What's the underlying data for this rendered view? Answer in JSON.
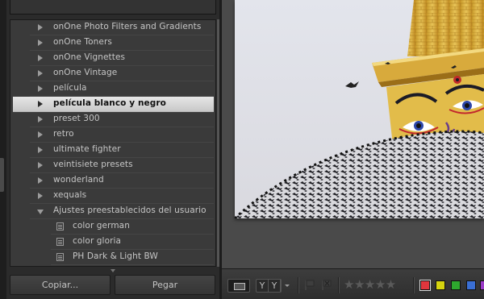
{
  "preset_list": {
    "items": [
      {
        "label": "onOne Photo Filters and Gradients",
        "kind": "folder",
        "state": "collapsed"
      },
      {
        "label": "onOne Toners",
        "kind": "folder",
        "state": "collapsed"
      },
      {
        "label": "onOne Vignettes",
        "kind": "folder",
        "state": "collapsed"
      },
      {
        "label": "onOne Vintage",
        "kind": "folder",
        "state": "collapsed"
      },
      {
        "label": "película",
        "kind": "folder",
        "state": "collapsed"
      },
      {
        "label": "película blanco y negro",
        "kind": "folder",
        "state": "collapsed",
        "selected": true
      },
      {
        "label": "preset 300",
        "kind": "folder",
        "state": "collapsed"
      },
      {
        "label": "retro",
        "kind": "folder",
        "state": "collapsed"
      },
      {
        "label": "ultimate fighter",
        "kind": "folder",
        "state": "collapsed"
      },
      {
        "label": "veintisiete presets",
        "kind": "folder",
        "state": "collapsed"
      },
      {
        "label": "wonderland",
        "kind": "folder",
        "state": "collapsed"
      },
      {
        "label": "xequals",
        "kind": "folder",
        "state": "collapsed"
      },
      {
        "label": "Ajustes preestablecidos del usuario",
        "kind": "folder",
        "state": "expanded"
      },
      {
        "label": "color german",
        "kind": "preset"
      },
      {
        "label": "color gloria",
        "kind": "preset"
      },
      {
        "label": "PH Dark & Light BW",
        "kind": "preset"
      }
    ]
  },
  "buttons": {
    "copy": "Copiar...",
    "paste": "Pegar"
  },
  "toolbar": {
    "compare_left": "Y",
    "compare_right": "Y",
    "stars": "★★★★★",
    "rating_value": 0,
    "color_labels": [
      {
        "name": "red",
        "color": "#e0363d",
        "selected": true
      },
      {
        "name": "yellow",
        "color": "#d6d40f"
      },
      {
        "name": "green",
        "color": "#2ea82e"
      },
      {
        "name": "blue",
        "color": "#3a6fd4"
      },
      {
        "name": "purple",
        "color": "#9b3ac8"
      }
    ]
  },
  "photo": {
    "subject": "stupa-with-eyes-and-pigeons"
  },
  "colors": {
    "panel_bg": "#3a3a3a",
    "selected_row": "#d8d8d8",
    "text": "#c6c6c6"
  }
}
